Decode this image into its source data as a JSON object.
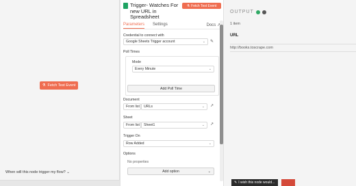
{
  "canvas": {
    "fetch_button": "Fetch Test Event",
    "question": "When will this node trigger my flow?"
  },
  "panel": {
    "title": "Trigger- Watches For new URL in Spreadsheet",
    "fetch_button": "Fetch Test Event",
    "tabs": [
      "Parameters",
      "Settings"
    ],
    "docs": "Docs",
    "credential_label": "Credential to connect with",
    "credential_value": "Google Sheets Trigger account",
    "poll_times_label": "Poll Times",
    "mode_label": "Mode",
    "mode_value": "Every Minute",
    "add_poll_time": "Add Poll Time",
    "document_label": "Document",
    "document_source": "From list",
    "document_value": "URLs",
    "sheet_label": "Sheet",
    "sheet_source": "From list",
    "sheet_value": "Sheet1",
    "trigger_on_label": "Trigger On",
    "trigger_on_value": "Row Added",
    "options_label": "Options",
    "no_properties": "No properties",
    "add_option": "Add option"
  },
  "output": {
    "title": "OUTPUT",
    "items": "1 item",
    "column": "URL",
    "value": "http://books.toscrape.com"
  },
  "footer": {
    "wish": "I wish this node would..."
  },
  "colors": {
    "accent": "#ef6d50",
    "sheets_green": "#1ea362",
    "success": "#2fa864"
  }
}
